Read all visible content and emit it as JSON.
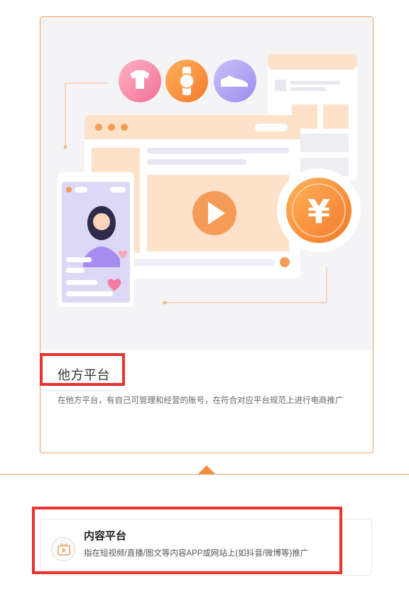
{
  "platform_card": {
    "title": "他方平台",
    "description": "在他方平台，有自己可管理和经营的账号，在符合对应平台规范上进行电商推广",
    "currency_symbol": "¥"
  },
  "content_platform": {
    "title": "内容平台",
    "description": "指在短视频/直播/图文等内容APP或网站上(如抖音/微博等)推广"
  },
  "colors": {
    "accent": "#f08d3c",
    "highlight_box": "#e8332f",
    "card_border": "#f0a060"
  }
}
